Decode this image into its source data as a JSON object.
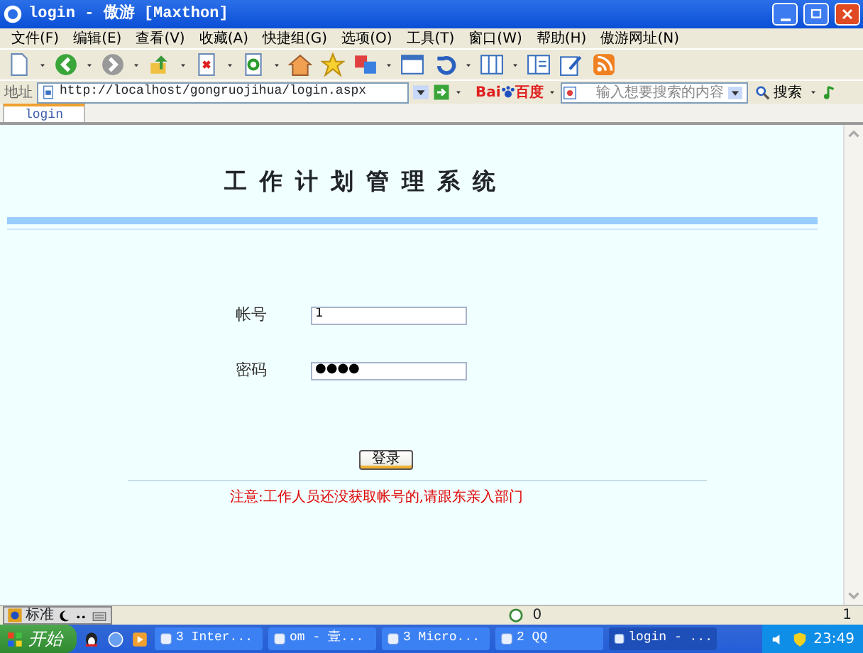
{
  "window": {
    "title": "login - 傲游 [Maxthon]"
  },
  "menu": [
    "文件(F)",
    "编辑(E)",
    "查看(V)",
    "收藏(A)",
    "快捷组(G)",
    "选项(O)",
    "工具(T)",
    "窗口(W)",
    "帮助(H)",
    "傲游网址(N)"
  ],
  "address_bar": {
    "label": "地址",
    "url": "http://localhost/gongruojihua/login.aspx"
  },
  "search": {
    "engine": [
      "Bai",
      "百度"
    ],
    "placeholder": "输入想要搜索的内容",
    "button": "搜索"
  },
  "tabs": [
    {
      "label": "login",
      "selected": true
    }
  ],
  "page": {
    "heading": "工作计划管理系统",
    "fields": [
      {
        "label": "帐号",
        "value": "1"
      },
      {
        "label": "密码",
        "value": "●●●●"
      }
    ],
    "button": "登录",
    "notice": "注意:工作人员还没获取帐号的,请跟东亲入部门"
  },
  "status_bar": {
    "ime": "标准",
    "items": [
      "0",
      "1"
    ]
  },
  "taskbar": {
    "start": "开始",
    "tasks": [
      {
        "label": "3 Inter...",
        "selected": false
      },
      {
        "label": "om - 壹...",
        "selected": false
      },
      {
        "label": "3 Micro...",
        "selected": false
      },
      {
        "label": "2 QQ",
        "selected": false
      },
      {
        "label": "login - ...",
        "selected": true
      }
    ],
    "clock": "23:49"
  }
}
